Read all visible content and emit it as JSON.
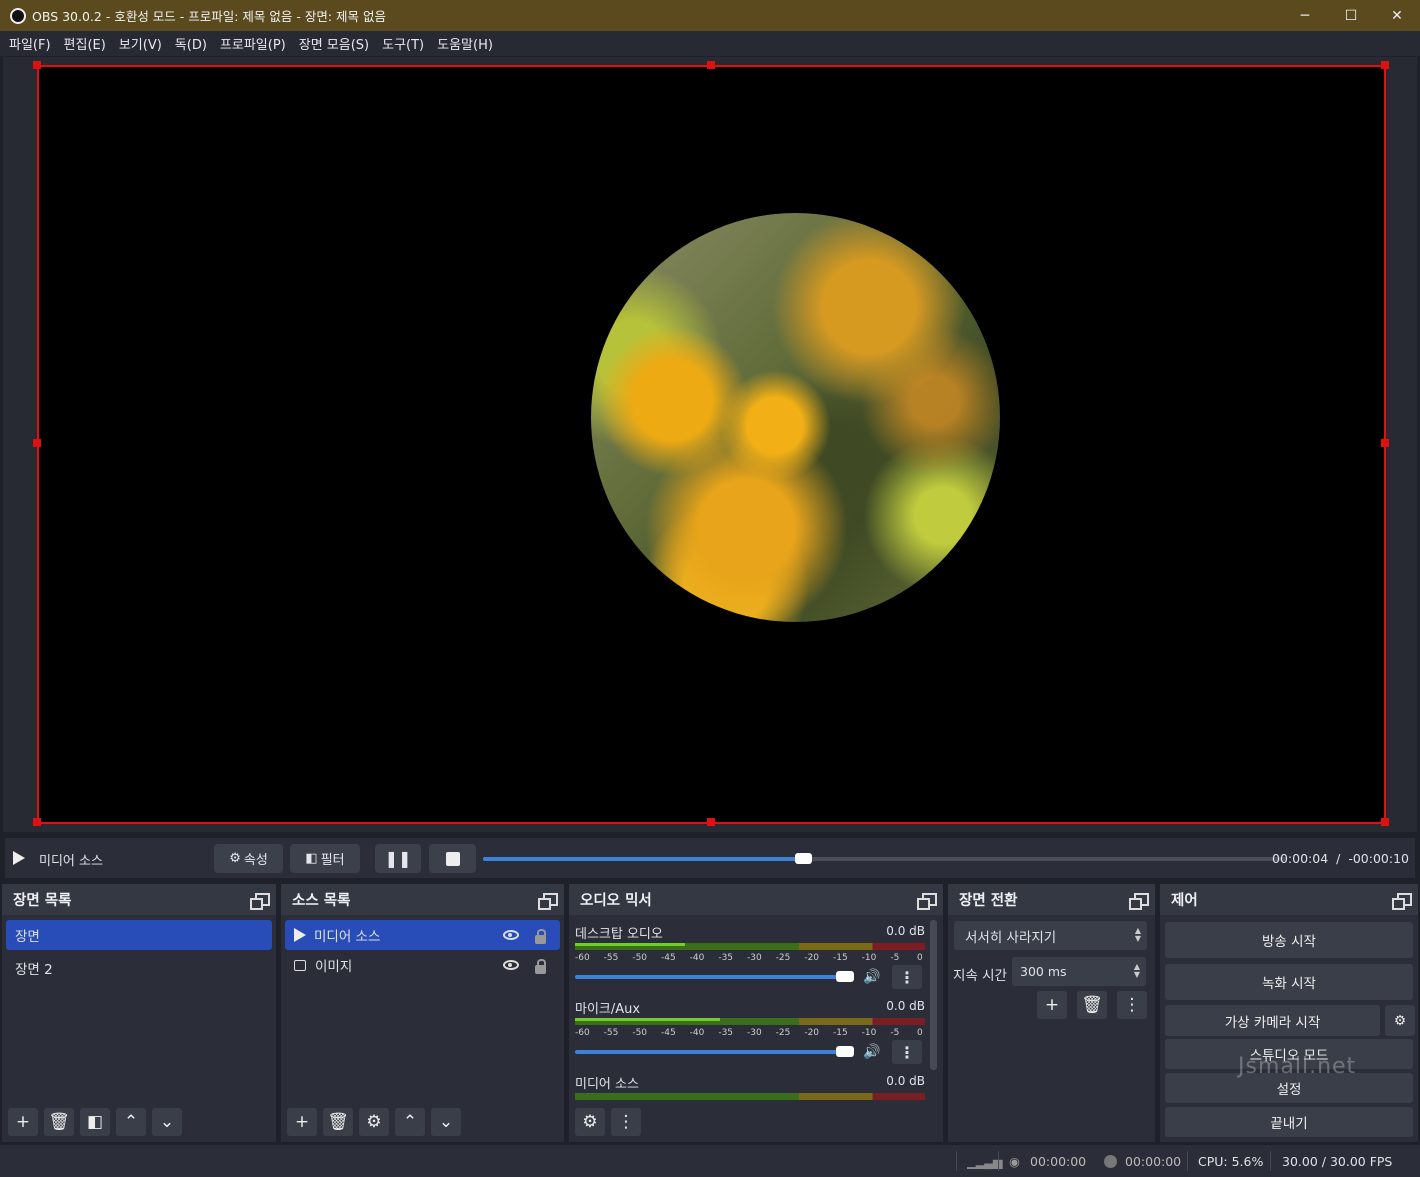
{
  "window": {
    "title": "OBS 30.0.2 - 호환성 모드 - 프로파일: 제목 없음 - 장면: 제목 없음",
    "minimize": "─",
    "maximize": "☐",
    "close": "✕"
  },
  "menu": [
    "파일(F)",
    "편집(E)",
    "보기(V)",
    "독(D)",
    "프로파일(P)",
    "장면 모음(S)",
    "도구(T)",
    "도움말(H)"
  ],
  "media": {
    "source_name": "미디어 소스",
    "properties_label": "속성",
    "filters_label": "필터",
    "progress": 0.4,
    "time_current": "00:00:04",
    "time_sep": "/",
    "time_remaining": "-00:00:10"
  },
  "scenes": {
    "title": "장면 목록",
    "items": [
      "장면",
      "장면 2"
    ],
    "selected": 0
  },
  "sources": {
    "title": "소스 목록",
    "items": [
      "미디어 소스",
      "이미지"
    ],
    "selected": 0
  },
  "mixer": {
    "title": "오디오 믹서",
    "ticks": [
      "-60",
      "-55",
      "-50",
      "-45",
      "-40",
      "-35",
      "-30",
      "-25",
      "-20",
      "-15",
      "-10",
      "-5",
      "0"
    ],
    "channels": [
      {
        "name": "데스크탑 오디오",
        "db": "0.0 dB"
      },
      {
        "name": "마이크/Aux",
        "db": "0.0 dB"
      },
      {
        "name": "미디어 소스",
        "db": "0.0 dB"
      }
    ]
  },
  "transitions": {
    "title": "장면 전환",
    "selected": "서서히 사라지기",
    "duration_label": "지속 시간",
    "duration_value": "300 ms"
  },
  "controls": {
    "title": "제어",
    "stream": "방송 시작",
    "record": "녹화 시작",
    "virtualcam": "가상 카메라 시작",
    "studio": "스튜디오 모드",
    "settings": "설정",
    "exit": "끝내기"
  },
  "status": {
    "stream_time": "00:00:00",
    "record_time": "00:00:00",
    "cpu": "CPU: 5.6%",
    "fps": "30.00 / 30.00 FPS"
  },
  "watermark": "Jsmall.net",
  "colors": {
    "accent": "#284cb8",
    "selection_border": "#e01010",
    "titlebar": "#5a4a1e"
  }
}
